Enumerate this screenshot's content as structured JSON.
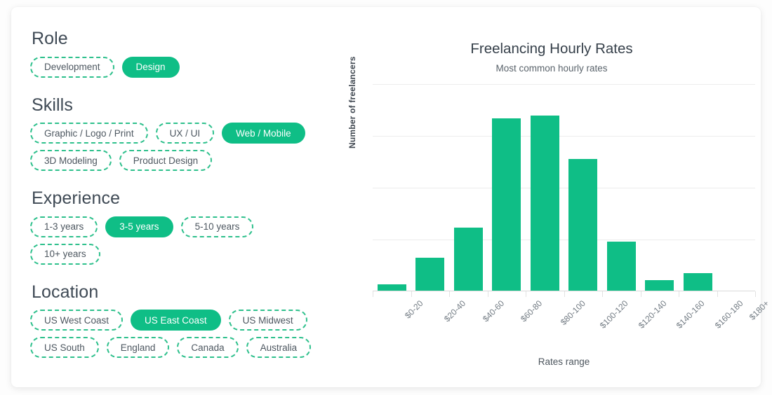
{
  "filters": {
    "sections": [
      {
        "title": "Role",
        "name": "role",
        "options": [
          {
            "label": "Development",
            "selected": false
          },
          {
            "label": "Design",
            "selected": true
          }
        ]
      },
      {
        "title": "Skills",
        "name": "skills",
        "options": [
          {
            "label": "Graphic / Logo / Print",
            "selected": false
          },
          {
            "label": "UX / UI",
            "selected": false
          },
          {
            "label": "Web / Mobile",
            "selected": true
          },
          {
            "label": "3D Modeling",
            "selected": false
          },
          {
            "label": "Product Design",
            "selected": false
          }
        ]
      },
      {
        "title": "Experience",
        "name": "experience",
        "options": [
          {
            "label": "1-3 years",
            "selected": false
          },
          {
            "label": "3-5 years",
            "selected": true
          },
          {
            "label": "5-10 years",
            "selected": false
          },
          {
            "label": "10+ years",
            "selected": false
          }
        ]
      },
      {
        "title": "Location",
        "name": "location",
        "options": [
          {
            "label": "US West Coast",
            "selected": false
          },
          {
            "label": "US East Coast",
            "selected": true
          },
          {
            "label": "US Midwest",
            "selected": false
          },
          {
            "label": "US South",
            "selected": false
          },
          {
            "label": "England",
            "selected": false
          },
          {
            "label": "Canada",
            "selected": false
          },
          {
            "label": "Australia",
            "selected": false
          }
        ]
      }
    ]
  },
  "colors": {
    "accent": "#0fbe86",
    "accent_dashed": "#2ec08c",
    "heading": "#3f4a55",
    "gridline": "#ececec",
    "card_background": "#ffffff"
  },
  "chart_data": {
    "type": "bar",
    "title": "Freelancing Hourly Rates",
    "subtitle": "Most common hourly rates",
    "xlabel": "Rates range",
    "ylabel": "Number of freelancers",
    "grid": true,
    "legend": false,
    "ylim": [
      0,
      4.05
    ],
    "yticks": [
      1,
      2,
      3,
      4
    ],
    "categories": [
      "$0-20",
      "$20-40",
      "$40-60",
      "$60-80",
      "$80-100",
      "$100-120",
      "$120-140",
      "$140-160",
      "$160-180",
      "$180+"
    ],
    "values": [
      0.12,
      0.64,
      1.21,
      3.32,
      3.37,
      2.54,
      0.94,
      0.2,
      0.34,
      0
    ]
  }
}
